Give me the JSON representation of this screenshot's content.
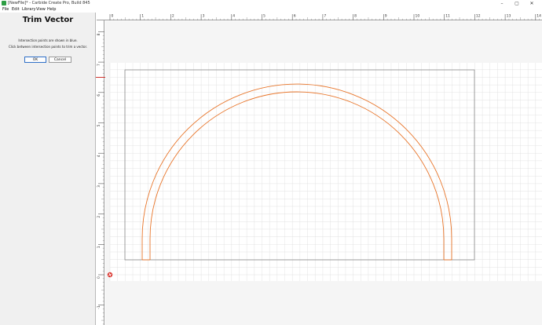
{
  "window": {
    "title": "[NewFile]* - Carbide Create Pro, Build 845",
    "minimize": "–",
    "maximize": "▢",
    "close": "✕"
  },
  "menu": [
    "File",
    "Edit",
    "Library",
    "View",
    "Help"
  ],
  "panel": {
    "title": "Trim Vector",
    "line1": "Intersection points are shown in blue.",
    "line2": "Click between intersection points to trim a vector.",
    "ok_label": "OK",
    "cancel_label": "Cancel"
  },
  "ruler": {
    "top_labels": [
      "0",
      "1",
      "2",
      "3",
      "4",
      "5",
      "6",
      "7",
      "8",
      "9",
      "10",
      "11",
      "12",
      "13",
      "14"
    ],
    "left_labels": [
      "8",
      "7",
      "6",
      "5",
      "4",
      "3",
      "2",
      "1",
      "0",
      "-1"
    ]
  },
  "colors": {
    "vector": "#e8752a",
    "stock_border": "#8a8a8a",
    "grid": "#dcdcdc",
    "accent": "#2f6fc7"
  },
  "icons": {
    "origin": "origin-marker-icon",
    "app": "carbide-create-icon"
  }
}
